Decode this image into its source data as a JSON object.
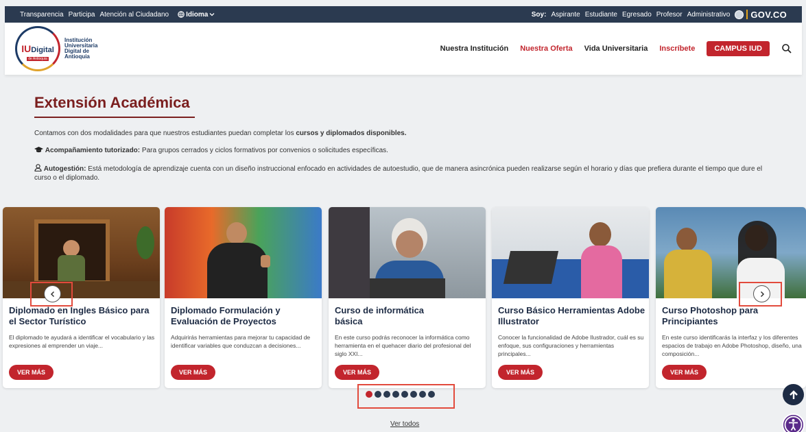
{
  "topbar": {
    "links": [
      "Transparencia",
      "Participa",
      "Atención al Ciudadano"
    ],
    "language": "Idioma",
    "soy_label": "Soy:",
    "roles": [
      "Aspirante",
      "Estudiante",
      "Egresado",
      "Profesor",
      "Administrativo"
    ],
    "gov_label": "GOV.CO"
  },
  "header": {
    "logo_mark": "IU",
    "logo_mark_word": "Digital",
    "logo_sub": "de Antioquia",
    "logo_lines": [
      "Institución",
      "Universitaria",
      "Digital de",
      "Antioquia"
    ],
    "nav": [
      "Nuestra Institución",
      "Nuestra Oferta",
      "Vida Universitaria",
      "Inscríbete"
    ],
    "campus_button": "CAMPUS IUD"
  },
  "main": {
    "title": "Extensión Académica",
    "intro_pre": "Contamos con dos modalidades para que nuestros estudiantes puedan completar los ",
    "intro_bold": "cursos y diplomados disponibles.",
    "tutor_bold": "Acompañamiento tutorizado:",
    "tutor_text": " Para grupos cerrados y ciclos formativos por convenios o solicitudes específicas.",
    "auto_bold": "Autogestión:",
    "auto_text": " Está metodología de aprendizaje cuenta con un diseño instruccional enfocado en actividades de autoestudio, que de manera asincrónica pueden realizarse según el horario y días que prefiera durante el tiempo que dure el curso o el diplomado."
  },
  "cards": [
    {
      "title": "Diplomado en Ingles Básico para el Sector Turístico",
      "desc": "El diplomado te ayudará a identificar el vocabulario y las expresiones al emprender un viaje...",
      "button": "VER MÁS"
    },
    {
      "title": "Diplomado Formulación y Evaluación de Proyectos",
      "desc": "Adquirirás herramientas para mejorar tu capacidad de identificar variables que conduzcan a decisiones...",
      "button": "VER MÁS"
    },
    {
      "title": "Curso de informática básica",
      "desc": "En este curso podrás reconocer la informática como herramienta en el quehacer diario del profesional del siglo XXI...",
      "button": "VER MÁS"
    },
    {
      "title": "Curso Básico Herramientas Adobe Illustrator",
      "desc": "Conocer la funcionalidad de Adobe Ilustrador, cuál es su enfoque, sus configuraciones y herramientas principales...",
      "button": "VER MÁS"
    },
    {
      "title": "Curso Photoshop para Principiantes",
      "desc": "En este curso identificarás la interfaz y los diferentes espacios de trabajo en Adobe Photoshop, diseño, una composición...",
      "button": "VER MÁS"
    }
  ],
  "carousel": {
    "total_dots": 8,
    "active_index": 0
  },
  "footer": {
    "ver_todos": "Ver todos"
  },
  "colors": {
    "brand_red": "#c2252d",
    "navy": "#2b3a50",
    "title": "#7a1e1e",
    "highlight": "#e24a3c"
  },
  "icons": [
    "globe-icon",
    "chevron-down-icon",
    "search-icon",
    "graduation-cap-icon",
    "user-icon",
    "arrow-left-icon",
    "arrow-right-icon",
    "arrow-up-icon",
    "accessibility-icon"
  ]
}
